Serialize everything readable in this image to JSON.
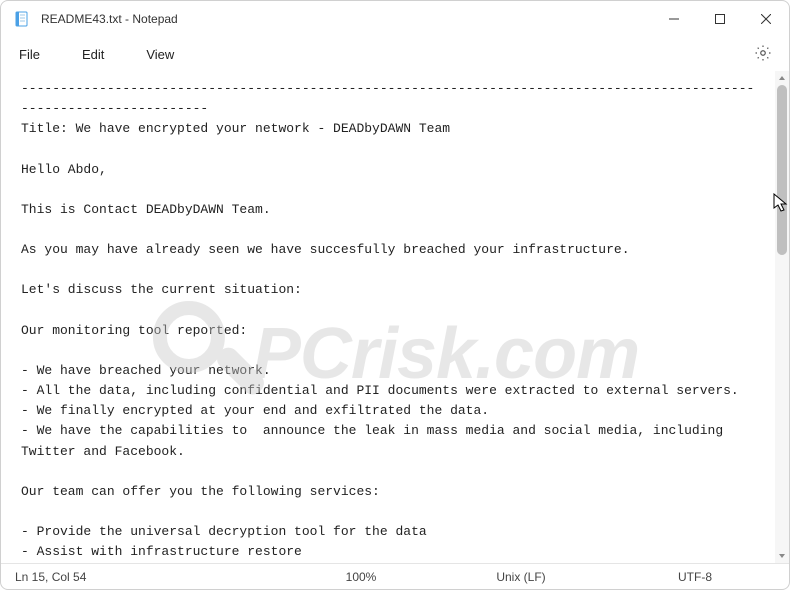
{
  "window": {
    "title": "README43.txt - Notepad"
  },
  "menu": {
    "file": "File",
    "edit": "Edit",
    "view": "View"
  },
  "document": {
    "text": "----------------------------------------------------------------------------------------------------------------------\nTitle: We have encrypted your network - DEADbyDAWN Team\n\nHello Abdo,\n\nThis is Contact DEADbyDAWN Team.\n\nAs you may have already seen we have succesfully breached your infrastructure.\n\nLet's discuss the current situation:\n\nOur monitoring tool reported:\n\n- We have breached your network.\n- All the data, including confidential and PII documents were extracted to external servers.\n- We finally encrypted at your end and exfiltrated the data.\n- We have the capabilities to  announce the leak in mass media and social media, including Twitter and Facebook.\n\nOur team can offer you the following services:\n\n- Provide the universal decryption tool for the data\n- Assist with infrastructure restore"
  },
  "status": {
    "position": "Ln 15, Col 54",
    "zoom": "100%",
    "line_ending": "Unix (LF)",
    "encoding": "UTF-8"
  },
  "watermark": {
    "text": "PCrisk.com"
  }
}
